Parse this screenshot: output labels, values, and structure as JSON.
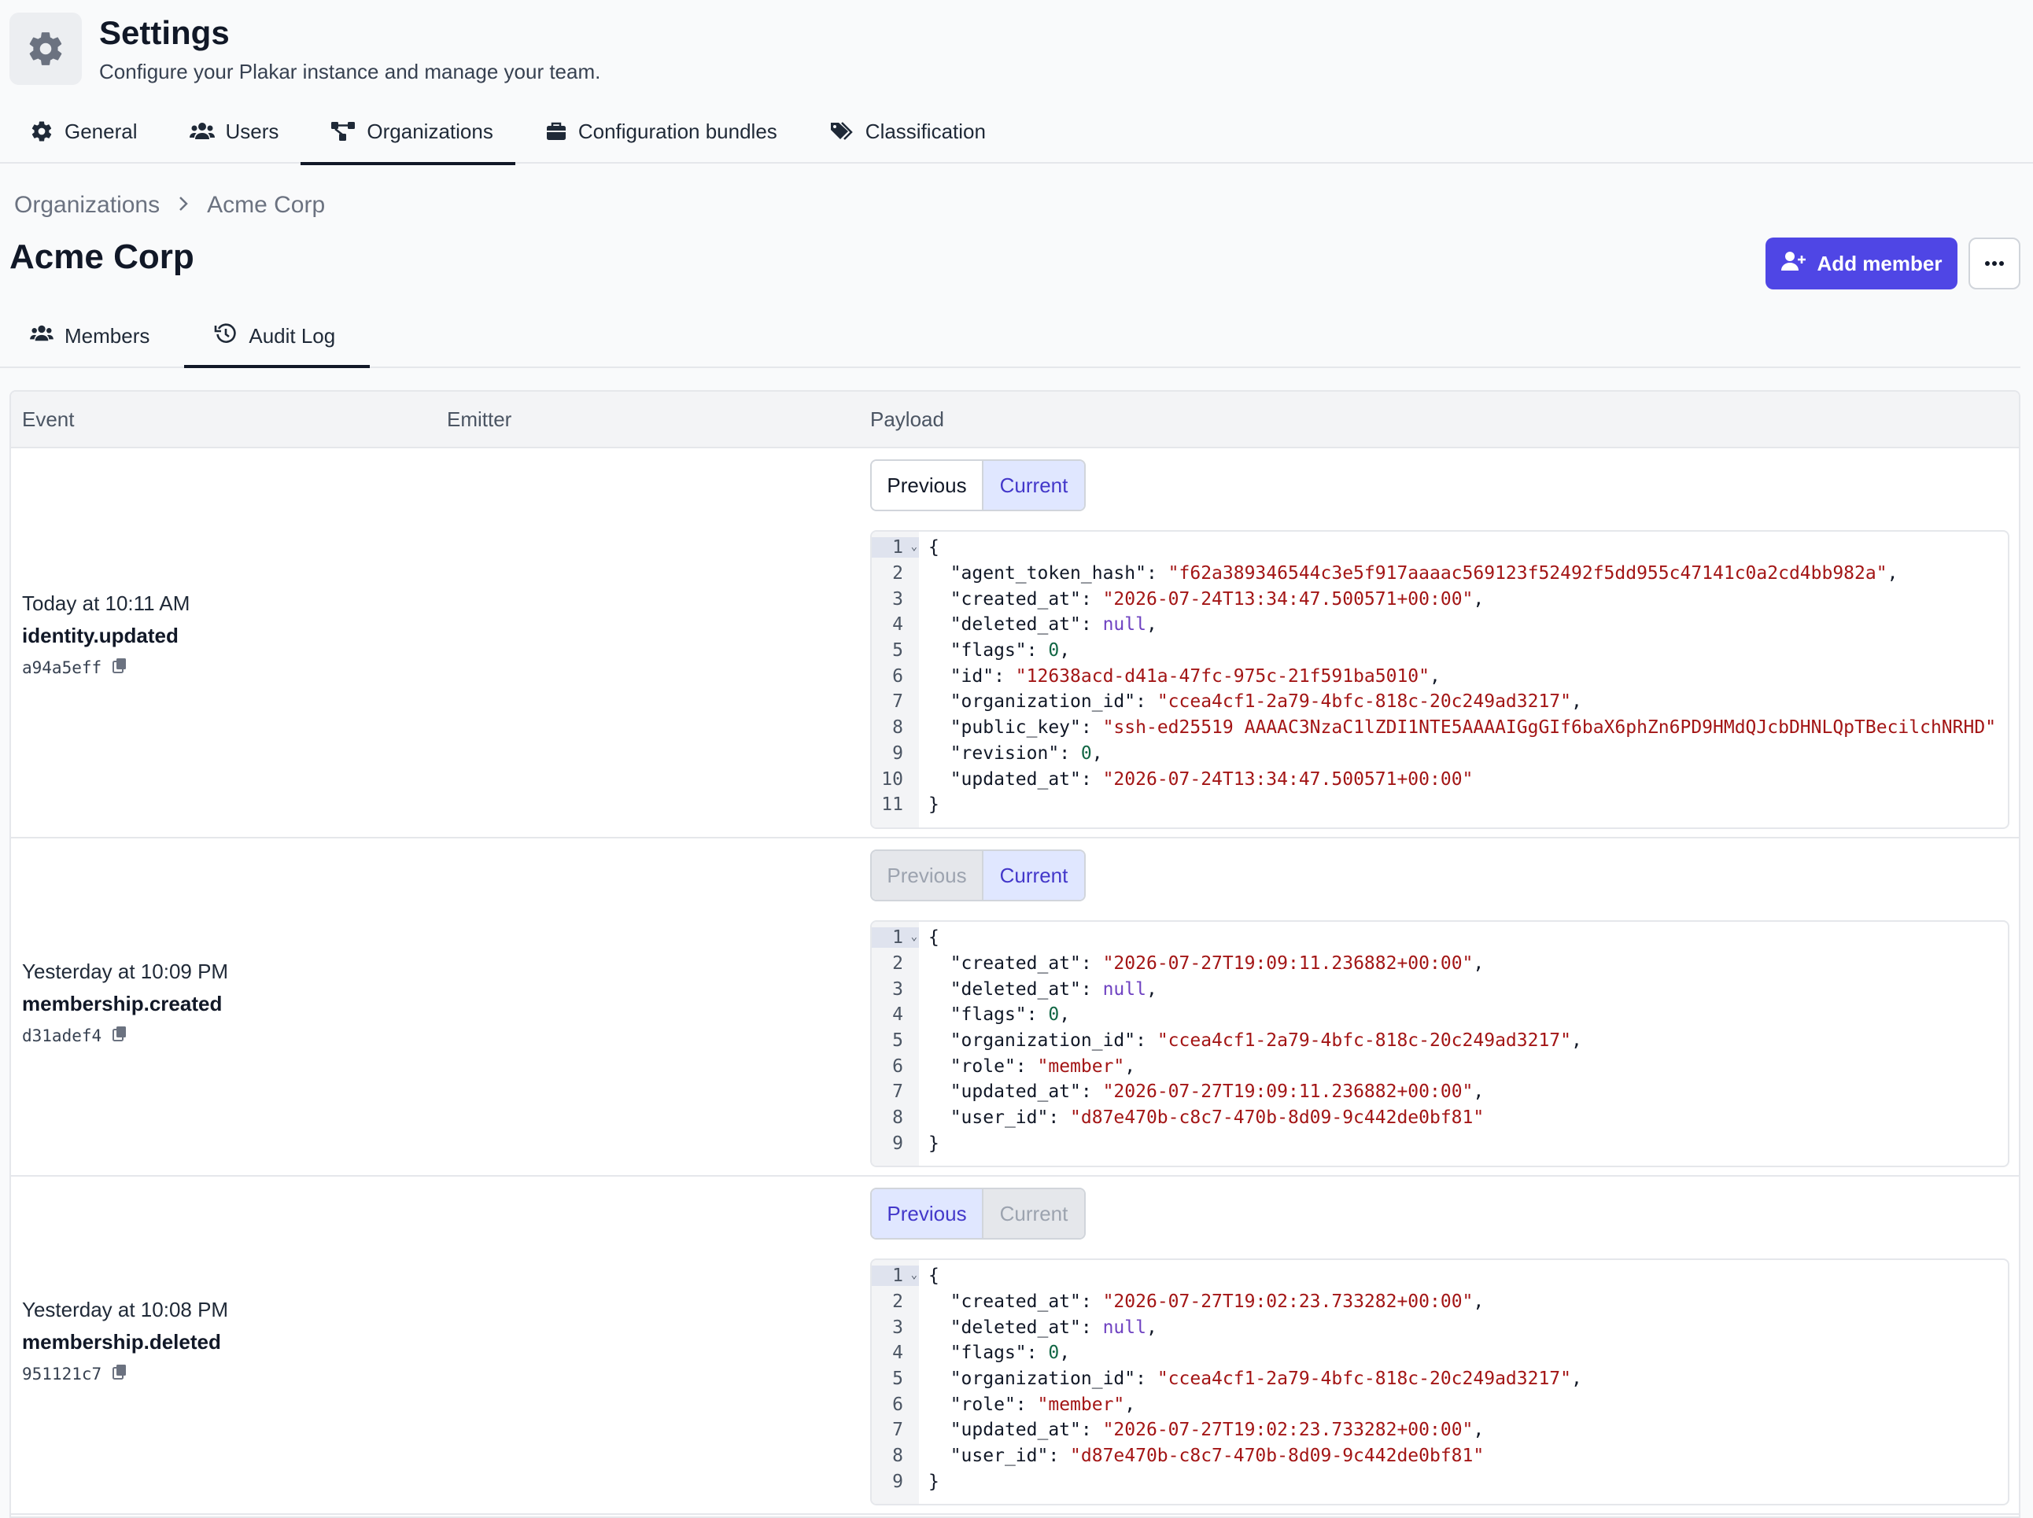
{
  "header": {
    "title": "Settings",
    "subtitle": "Configure your Plakar instance and manage your team.",
    "tabs": [
      {
        "label": "General",
        "icon": "gear-icon",
        "active": false
      },
      {
        "label": "Users",
        "icon": "users-icon",
        "active": false
      },
      {
        "label": "Organizations",
        "icon": "organizations-icon",
        "active": true
      },
      {
        "label": "Configuration bundles",
        "icon": "briefcase-icon",
        "active": false
      },
      {
        "label": "Classification",
        "icon": "tags-icon",
        "active": false
      }
    ]
  },
  "breadcrumb": {
    "root": "Organizations",
    "current": "Acme Corp"
  },
  "page": {
    "title": "Acme Corp",
    "add_member_label": "Add member",
    "more_label": "•••",
    "tabs": [
      {
        "label": "Members",
        "icon": "users-icon",
        "active": false
      },
      {
        "label": "Audit Log",
        "icon": "history-icon",
        "active": true
      }
    ]
  },
  "table": {
    "columns": [
      "Event",
      "Emitter",
      "Payload"
    ],
    "toggle_labels": {
      "previous": "Previous",
      "current": "Current"
    },
    "rows": [
      {
        "time": "Today at 10:11 AM",
        "event": "identity.updated",
        "id": "a94a5eff",
        "emitter": "",
        "toggle": {
          "previous": "off",
          "current": "on"
        },
        "payload": [
          "{",
          "  \"agent_token_hash\": \"f62a389346544c3e5f917aaaac569123f52492f5dd955c47141c0a2cd4bb982a\",",
          "  \"created_at\": \"2026-07-24T13:34:47.500571+00:00\",",
          "  \"deleted_at\": null,",
          "  \"flags\": 0,",
          "  \"id\": \"12638acd-d41a-47fc-975c-21f591ba5010\",",
          "  \"organization_id\": \"ccea4cf1-2a79-4bfc-818c-20c249ad3217\",",
          "  \"public_key\": \"ssh-ed25519 AAAAC3NzaC1lZDI1NTE5AAAAIGgGIf6baX6phZn6PD9HMdQJcbDHNLQpTBecilchNRHD\"",
          "  \"revision\": 0,",
          "  \"updated_at\": \"2026-07-24T13:34:47.500571+00:00\"",
          "}"
        ]
      },
      {
        "time": "Yesterday at 10:09 PM",
        "event": "membership.created",
        "id": "d31adef4",
        "emitter": "",
        "toggle": {
          "previous": "disabled",
          "current": "on"
        },
        "payload": [
          "{",
          "  \"created_at\": \"2026-07-27T19:09:11.236882+00:00\",",
          "  \"deleted_at\": null,",
          "  \"flags\": 0,",
          "  \"organization_id\": \"ccea4cf1-2a79-4bfc-818c-20c249ad3217\",",
          "  \"role\": \"member\",",
          "  \"updated_at\": \"2026-07-27T19:09:11.236882+00:00\",",
          "  \"user_id\": \"d87e470b-c8c7-470b-8d09-9c442de0bf81\"",
          "}"
        ]
      },
      {
        "time": "Yesterday at 10:08 PM",
        "event": "membership.deleted",
        "id": "951121c7",
        "emitter": "",
        "toggle": {
          "previous": "on",
          "current": "disabled"
        },
        "payload": [
          "{",
          "  \"created_at\": \"2026-07-27T19:02:23.733282+00:00\",",
          "  \"deleted_at\": null,",
          "  \"flags\": 0,",
          "  \"organization_id\": \"ccea4cf1-2a79-4bfc-818c-20c249ad3217\",",
          "  \"role\": \"member\",",
          "  \"updated_at\": \"2026-07-27T19:02:23.733282+00:00\",",
          "  \"user_id\": \"d87e470b-c8c7-470b-8d09-9c442de0bf81\"",
          "}"
        ]
      }
    ]
  },
  "colors": {
    "accent": "#4f46e5",
    "toggle_active_bg": "#e0e7ff",
    "toggle_active_text": "#4338ca",
    "json_string": "#a31515",
    "json_null": "#6f42c1",
    "json_number": "#116644"
  }
}
